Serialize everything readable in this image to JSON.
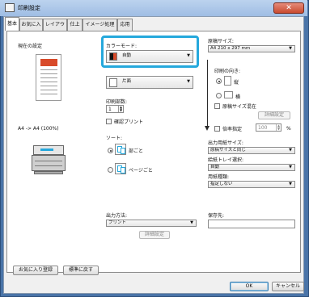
{
  "window": {
    "title": "印刷設定",
    "close": "✕"
  },
  "tabs": [
    "基本",
    "お気に入り",
    "レイアウト",
    "仕上げ",
    "イメージ処理",
    "応用"
  ],
  "left": {
    "current_settings": "現在の設定",
    "size_caption": "A4 -> A4 (100%)"
  },
  "color_mode": {
    "label": "カラーモード:",
    "value": "自動"
  },
  "duplex": {
    "value": "片面"
  },
  "copies": {
    "label": "印刷部数:",
    "value": "1"
  },
  "confirm_print": {
    "label": "確認プリント"
  },
  "sort": {
    "label": "ソート:",
    "options": [
      "部ごと",
      "ページごと"
    ],
    "selected": 0
  },
  "output": {
    "label": "出力方法:",
    "value": "プリント",
    "detail_button": "詳細設定"
  },
  "save_to": {
    "label": "保存先:",
    "value": ""
  },
  "paper": {
    "label": "原稿サイズ:",
    "value": "A4 210 x 297 mm",
    "orientation_label": "印刷の向き:",
    "orientations": [
      "縦",
      "横"
    ],
    "selected": 0,
    "mixed_label": "原稿サイズ混在",
    "mixed_detail": "詳細設定"
  },
  "zoom": {
    "label": "倍率指定",
    "value": "100",
    "unit": "%"
  },
  "out_paper": {
    "label": "出力用紙サイズ:",
    "value": "原稿サイズと同じ"
  },
  "tray": {
    "label": "給紙トレイ選択:",
    "value": "自動"
  },
  "paper_type": {
    "label": "用紙種類:",
    "value": "指定しない"
  },
  "footer": {
    "favorite_register": "お気に入り登録",
    "restore_defaults": "標準に戻す",
    "ok": "OK",
    "cancel": "キャンセル"
  },
  "colors": {
    "highlight": "#25a8dc",
    "accent": "#d84a2a"
  }
}
